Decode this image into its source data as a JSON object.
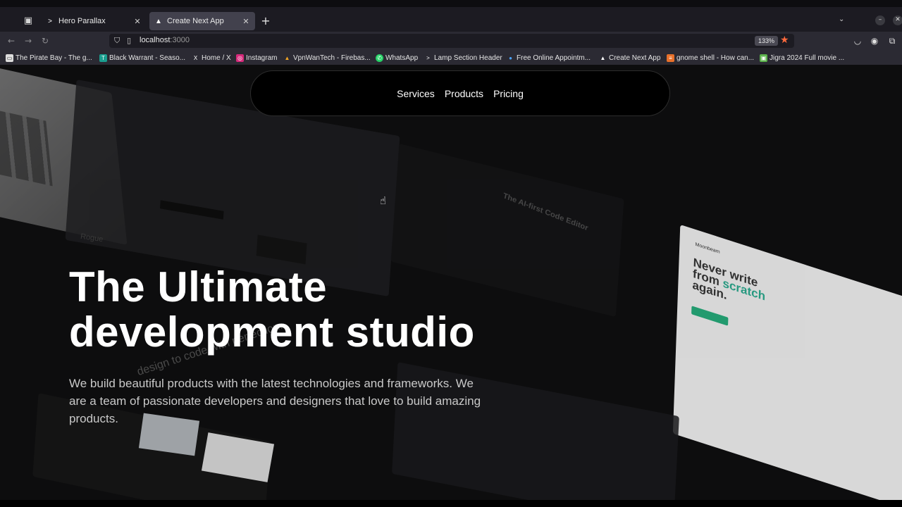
{
  "browser": {
    "tabs": [
      {
        "title": "Hero Parallax",
        "active": false
      },
      {
        "title": "Create Next App",
        "active": true
      }
    ],
    "new_tab_label": "+",
    "url": {
      "host": "localhost",
      "port": ":3000"
    },
    "zoom": "133%",
    "bookmarks": [
      "The Pirate Bay - The g...",
      "Black Warrant - Seaso...",
      "Home / X",
      "Instagram",
      "VpnWanTech - Firebas...",
      "WhatsApp",
      "Lamp Section Header",
      "Free Online Appointm...",
      "Create Next App",
      "gnome shell - How can...",
      "Jigra 2024 Full movie ..."
    ]
  },
  "page": {
    "nav": [
      "Services",
      "Products",
      "Pricing"
    ],
    "hero": {
      "title_line1": "The Ultimate",
      "title_line2": "development studio",
      "subtitle": "We build beautiful products with the latest technologies and frameworks. We are a team of passionate developers and designers that love to build amazing products."
    },
    "background_cards": {
      "rogue_label": "Rogue",
      "code_editor_label": "The AI-first Code Editor",
      "moonbeam_logo": "Moonbeam",
      "moonbeam_headline_1": "Never write",
      "moonbeam_headline_2": "from",
      "moonbeam_headline_accent": "scratch",
      "moonbeam_headline_3": "again.",
      "design_text": "design to code with perfection."
    }
  },
  "colors": {
    "accent_star": "#ff6a3d",
    "moonbeam_accent": "#2aa58a",
    "nav_bg": "#000000"
  }
}
